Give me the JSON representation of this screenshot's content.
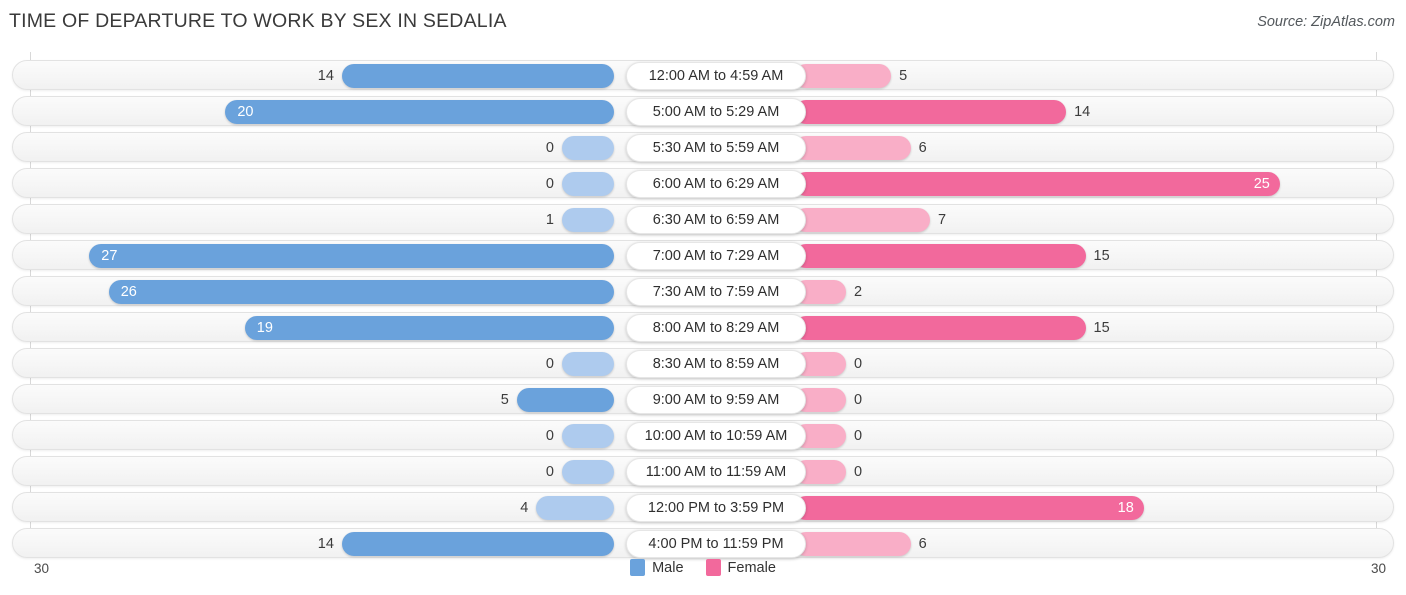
{
  "title": "TIME OF DEPARTURE TO WORK BY SEX IN SEDALIA",
  "source": "Source: ZipAtlas.com",
  "axis": {
    "left": "30",
    "right": "30"
  },
  "legend": [
    {
      "label": "Male",
      "color": "#6aa2dc",
      "swatch": "male-swatch"
    },
    {
      "label": "Female",
      "color": "#f2699c",
      "swatch": "female-swatch"
    }
  ],
  "chart_data": {
    "type": "bar",
    "orientation": "horizontal-diverging",
    "title": "TIME OF DEPARTURE TO WORK BY SEX IN SEDALIA",
    "xlabel": "",
    "ylabel": "",
    "xlim": [
      30,
      30
    ],
    "grid": true,
    "legend_position": "bottom-center",
    "categories": [
      "12:00 AM to 4:59 AM",
      "5:00 AM to 5:29 AM",
      "5:30 AM to 5:59 AM",
      "6:00 AM to 6:29 AM",
      "6:30 AM to 6:59 AM",
      "7:00 AM to 7:29 AM",
      "7:30 AM to 7:59 AM",
      "8:00 AM to 8:29 AM",
      "8:30 AM to 8:59 AM",
      "9:00 AM to 9:59 AM",
      "10:00 AM to 10:59 AM",
      "11:00 AM to 11:59 AM",
      "12:00 PM to 3:59 PM",
      "4:00 PM to 11:59 PM"
    ],
    "series": [
      {
        "name": "Male",
        "color": "#6aa2dc",
        "values": [
          14,
          20,
          0,
          0,
          1,
          27,
          26,
          19,
          0,
          5,
          0,
          0,
          4,
          14
        ]
      },
      {
        "name": "Female",
        "color": "#f2699c",
        "values": [
          5,
          14,
          6,
          25,
          7,
          15,
          2,
          15,
          0,
          0,
          0,
          0,
          18,
          6
        ]
      }
    ]
  }
}
